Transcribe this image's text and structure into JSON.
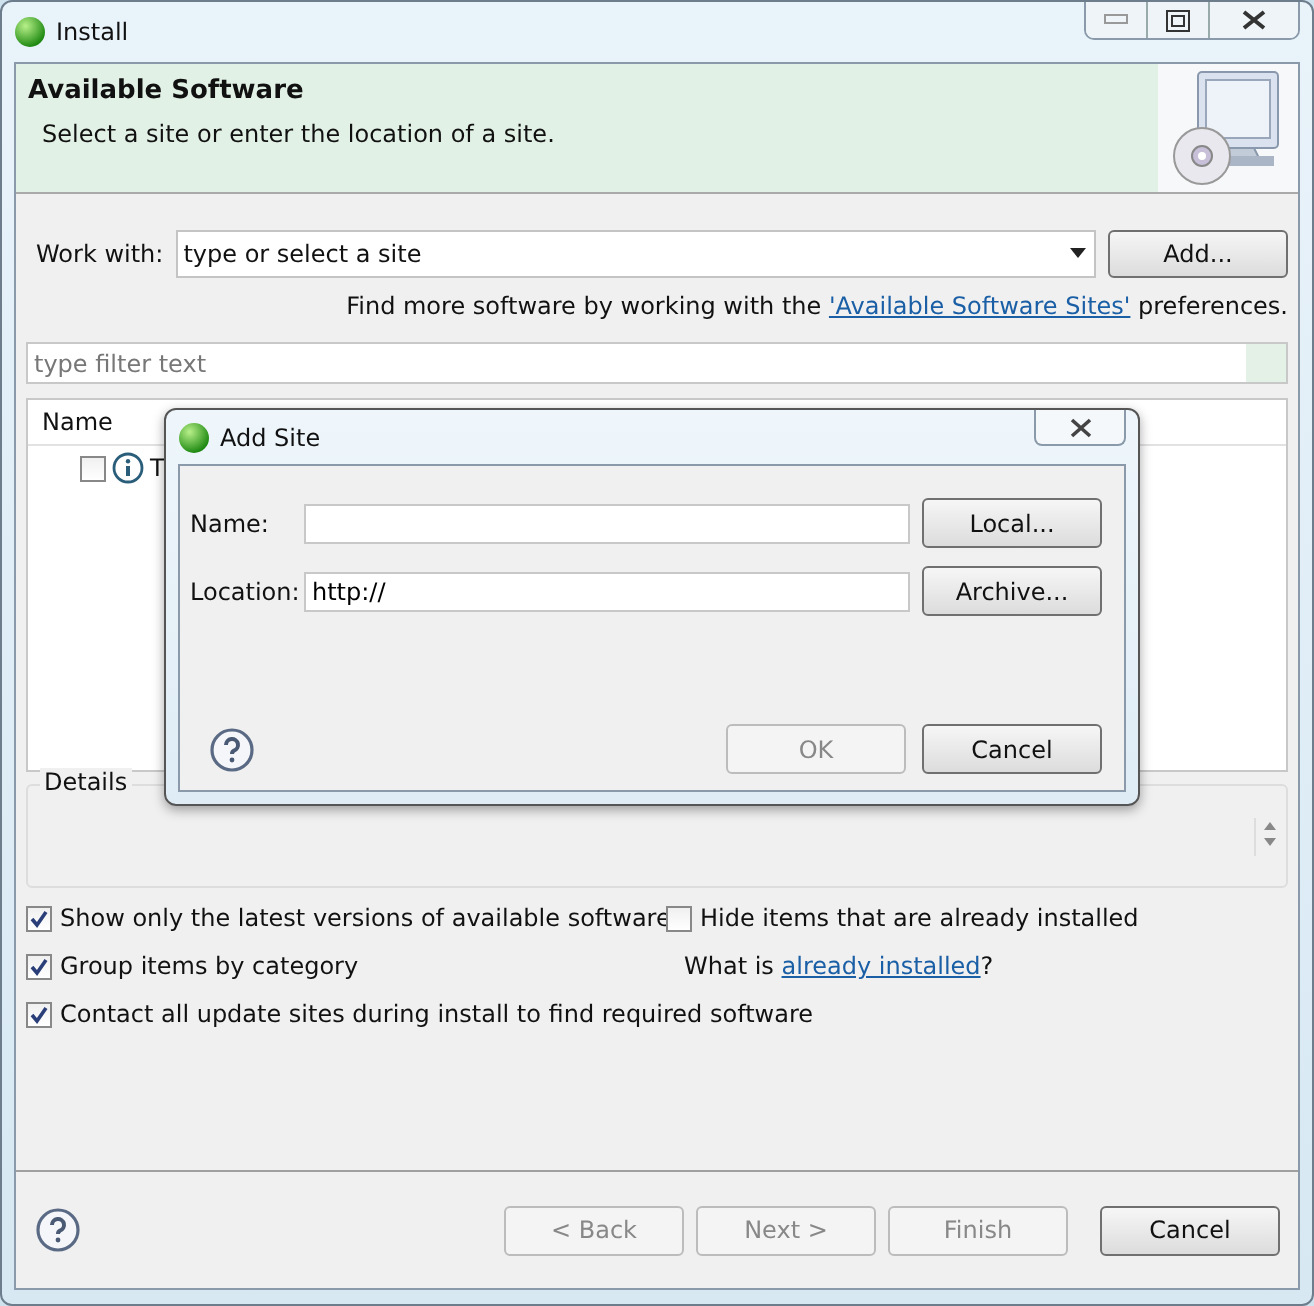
{
  "window": {
    "title": "Install"
  },
  "header": {
    "title": "Available Software",
    "subtitle": "Select a site or enter the location of a site."
  },
  "work_with": {
    "label": "Work with:",
    "placeholder": "type or select a site",
    "button": "Add..."
  },
  "hint": {
    "text": "Find more software by working with the ",
    "link": "'Available Software Sites'",
    "suffix": " preferences."
  },
  "filter": {
    "placeholder": "type filter text"
  },
  "table": {
    "columns": [
      "Name"
    ],
    "rows": [
      {
        "checked": false,
        "label": "T"
      }
    ]
  },
  "details": {
    "label": "Details"
  },
  "option_rows": [
    [
      {
        "kind": "checkbox",
        "label": "Show only the latest versions of available software",
        "checked": true
      },
      {
        "kind": "checkbox",
        "label": "Hide items that are already installed",
        "checked": false
      }
    ],
    [
      {
        "kind": "checkbox",
        "label": "Group items by category",
        "checked": true
      },
      {
        "kind": "link_text",
        "text": "What is ",
        "link": "already installed",
        "suffix": "?"
      }
    ],
    [
      {
        "kind": "checkbox",
        "label": "Contact all update sites during install to find required software",
        "checked": true
      }
    ]
  ],
  "buttons": [
    {
      "label": "< Back",
      "disabled": true
    },
    {
      "label": "Next >",
      "disabled": true
    },
    {
      "label": "Finish",
      "disabled": true
    },
    {
      "label": "Cancel",
      "disabled": false
    }
  ],
  "dialog": {
    "title": "Add Site",
    "fields": [
      {
        "label": "Name:",
        "button": "Local..."
      },
      {
        "label": "Location:",
        "value": "http://",
        "button": "Archive..."
      }
    ],
    "buttons": [
      {
        "label": "OK",
        "disabled": true
      },
      {
        "label": "Cancel",
        "disabled": false
      }
    ]
  }
}
